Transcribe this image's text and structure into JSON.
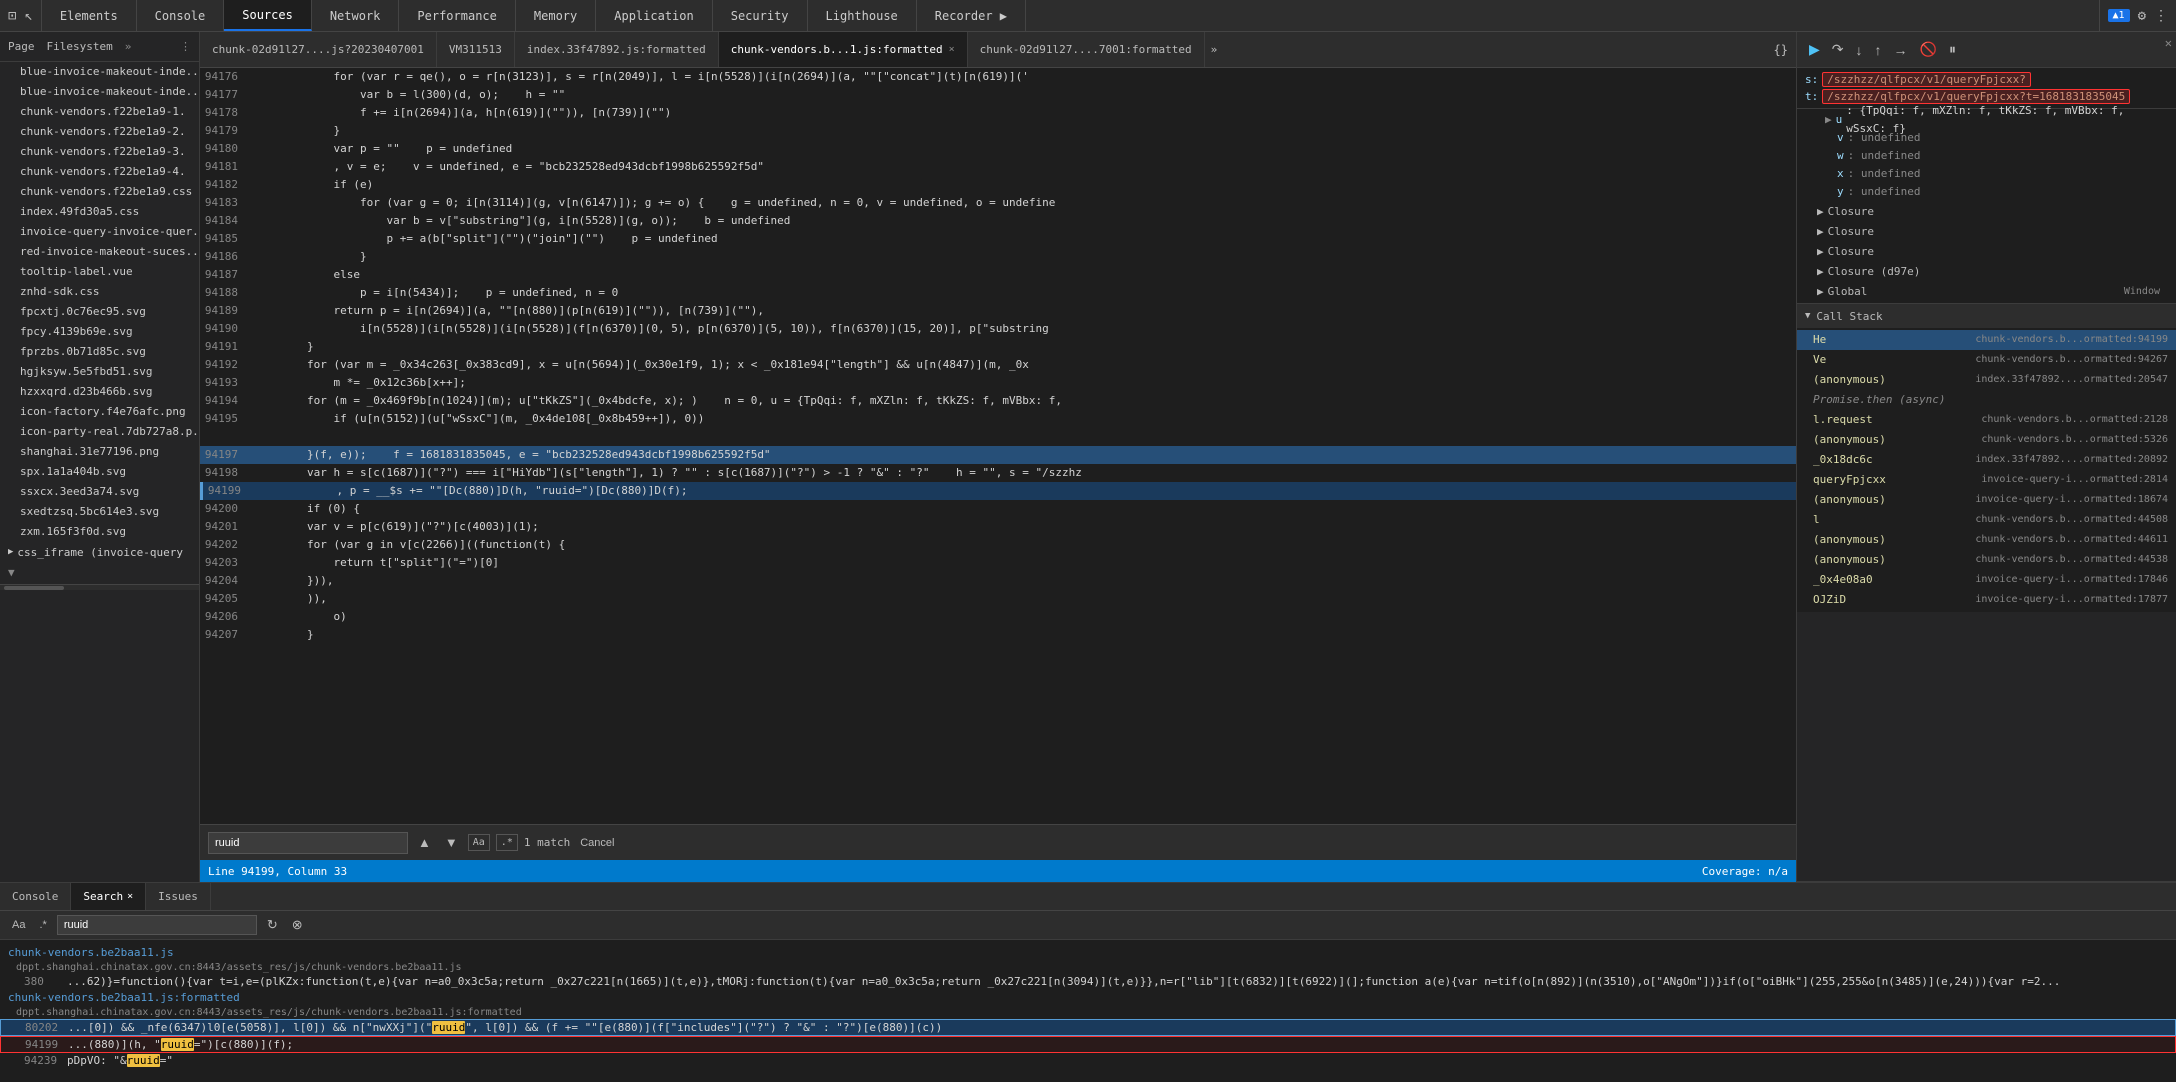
{
  "tabs": {
    "items": [
      "Elements",
      "Console",
      "Sources",
      "Network",
      "Performance",
      "Memory",
      "Application",
      "Security",
      "Lighthouse",
      "Recorder ▶"
    ]
  },
  "topbar": {
    "active_tab": "Sources",
    "icons": {
      "device": "⊡",
      "elements": "☰",
      "settings": "⚙",
      "overflow": "⋮"
    }
  },
  "sidebar": {
    "header_tabs": [
      "Page",
      "Filesystem"
    ],
    "more": "»",
    "files": [
      "blue-invoice-makeout-inde...",
      "blue-invoice-makeout-inde...",
      "chunk-vendors.f22be1a9-1.",
      "chunk-vendors.f22be1a9-2.",
      "chunk-vendors.f22be1a9-3.",
      "chunk-vendors.f22be1a9-4.",
      "chunk-vendors.f22be1a9.css",
      "index.49fd30a5.css",
      "invoice-query-invoice-quer...",
      "red-invoice-makeout-suces...",
      "tooltip-label.vue",
      "znhd-sdk.css",
      "fpcxtj.0c76ec95.svg",
      "fpcy.4139b69e.svg",
      "fprzbs.0b71d85c.svg",
      "hgjksyw.5e5fbd51.svg",
      "hzxxqrd.d23b466b.svg",
      "icon-factory.f4e76afc.png",
      "icon-party-real.7db727a8.p...",
      "shanghai.31e77196.png",
      "spx.1a1a404b.svg",
      "ssxcx.3eed3a74.svg",
      "sxedtzsq.5bc614e3.svg",
      "zxm.165f3f0d.svg"
    ],
    "groups": [
      "css_iframe (invoice-query"
    ]
  },
  "file_tabs": [
    {
      "name": "chunk-02d91l27....js?20230407001",
      "active": false,
      "closable": false
    },
    {
      "name": "VM311513",
      "active": false,
      "closable": false
    },
    {
      "name": "index.33f47892.js:formatted",
      "active": false,
      "closable": false
    },
    {
      "name": "chunk-vendors.b...1.js:formatted",
      "active": true,
      "closable": true
    },
    {
      "name": "chunk-02d91l27....7001:formatted",
      "active": false,
      "closable": false
    }
  ],
  "code": {
    "lines": [
      {
        "num": "94176",
        "content": "            for (var r = qe(), o = r[n(3123)], s = r[n(2049)], l = i[n(5528)](i[n(2694)](a, \"\"[\"concat\"](t)[n(619)]('",
        "highlighted": false,
        "current": false
      },
      {
        "num": "94177",
        "content": "                var b = l(300)(d, o);    h = \"\"",
        "highlighted": false,
        "current": false
      },
      {
        "num": "94178",
        "content": "                f += i[n(2694)](a, h[n(619)](\"\")), [n(739)](\"\")",
        "highlighted": false,
        "current": false
      },
      {
        "num": "94179",
        "content": "            }",
        "highlighted": false,
        "current": false
      },
      {
        "num": "94180",
        "content": "            var p = \"\"    p = undefined",
        "highlighted": false,
        "current": false
      },
      {
        "num": "94181",
        "content": "            , v = e;    v = undefined, e = \"bcb232528ed943dcbf1998b625592f5d\"",
        "highlighted": false,
        "current": false
      },
      {
        "num": "94182",
        "content": "            if (e)",
        "highlighted": false,
        "current": false
      },
      {
        "num": "94183",
        "content": "                for (var g = 0; i[n(3114)](g, v[n(6147)]); g += o) {    g = undefined, n = 0, v = undefined, o = undefine",
        "highlighted": false,
        "current": false
      },
      {
        "num": "94184",
        "content": "                    var b = v[\"substring\"](g, i[n(5528)](g, o));    b = undefined",
        "highlighted": false,
        "current": false
      },
      {
        "num": "94185",
        "content": "                    p += a(b[\"split\"](\"\")(\"join\"](\"\")    p = undefined",
        "highlighted": false,
        "current": false
      },
      {
        "num": "94186",
        "content": "                }",
        "highlighted": false,
        "current": false
      },
      {
        "num": "94187",
        "content": "            else",
        "highlighted": false,
        "current": false
      },
      {
        "num": "94188",
        "content": "                p = i[n(5434)];    p = undefined, n = 0",
        "highlighted": false,
        "current": false
      },
      {
        "num": "94189",
        "content": "            return p = i[n(2694)](a, \"\"[n(880)](p[n(619)](\"\")), [n(739)](\"\"),",
        "highlighted": false,
        "current": false
      },
      {
        "num": "94190",
        "content": "                i[n(5528)](i[n(5528)](i[n(5528)](f[n(6370)](0, 5), p[n(6370)](5, 10)), f[n(6370)](15, 20)], p[\"substring",
        "highlighted": false,
        "current": false
      },
      {
        "num": "94191",
        "content": "        }",
        "highlighted": false,
        "current": false
      },
      {
        "num": "94192",
        "content": "        for (var m = _0x34c263[_0x383cd9], x = u[n(5694)](_0x30e1f9, 1); x < _0x181e94[\"length\"] && u[n(4847)](m, _0x",
        "highlighted": false,
        "current": false
      },
      {
        "num": "94193",
        "content": "            m *= _0x12c36b[x++];",
        "highlighted": false,
        "current": false
      },
      {
        "num": "94194",
        "content": "        for (m = _0x469f9b[n(1024)](m); u[\"tKkZS\"](_0x4bdcfe, x); )    n = 0, u = {TpQqi: f, mXZln: f, tKkZS: f, mVBbx: f,",
        "highlighted": false,
        "current": false
      },
      {
        "num": "94195",
        "content": "            if (u[n(5152)](u[\"wSsxC\"](m, _0x4de108[_0x8b459++]), 0))",
        "highlighted": false,
        "current": false
      },
      {
        "num": "",
        "content": "",
        "highlighted": false,
        "current": false
      },
      {
        "num": "94197",
        "content": "        }(f, e));    f = 1681831835045, e = \"bcb232528ed943dcbf1998b625592f5d\"",
        "highlighted": true,
        "current": false
      },
      {
        "num": "94198",
        "content": "        var h = s[c(1687)](\"?\") === i[\"HiYdb\"](s[\"length\"], 1) ? \"\" : s[c(1687)](\"?\") > -1 ? \"&\" : \"?\"    h = \"\", s = \"/szzhz",
        "highlighted": false,
        "current": false
      },
      {
        "num": "94199",
        "content": "            , p = __$s += \"\"[Dc(880)]D(h, \"ruuid=\")[Dc(880)]D(f);",
        "highlighted": false,
        "current": true
      },
      {
        "num": "94200",
        "content": "        if (0) {",
        "highlighted": false,
        "current": false
      },
      {
        "num": "94201",
        "content": "        var v = p[c(619)](\"?\")[c(4003)](1);",
        "highlighted": false,
        "current": false
      },
      {
        "num": "94202",
        "content": "        for (var g in v[c(2266)]((function(t) {",
        "highlighted": false,
        "current": false
      },
      {
        "num": "94203",
        "content": "            return t[\"split\"](\"=\")[0]",
        "highlighted": false,
        "current": false
      },
      {
        "num": "94204",
        "content": "        })),",
        "highlighted": false,
        "current": false
      },
      {
        "num": "94205",
        "content": "        )),",
        "highlighted": false,
        "current": false
      },
      {
        "num": "94206",
        "content": "            o)",
        "highlighted": false,
        "current": false
      },
      {
        "num": "94207",
        "content": "        }",
        "highlighted": false,
        "current": false
      }
    ]
  },
  "right_panel": {
    "toolbar": {
      "buttons": [
        "▶",
        "⏸",
        "↷",
        "↓",
        "↑",
        "⏫",
        "⏬",
        "🚫",
        "⏹"
      ]
    },
    "network_highlighted": {
      "s_value": "/szzhzz/qlfpcx/v1/queryFpjcxx?",
      "t_value": "/szzhzz/qlfpcx/v1/queryFpjcxx?t=1681831835045"
    },
    "scope_items": [
      {
        "type": "object",
        "key": "u",
        "val": "{TpQqi: f, mXZln: f, tKkZS: f, mVBbx: f, wSsxC: f}"
      },
      {
        "type": "value",
        "key": "v",
        "val": "undefined"
      },
      {
        "type": "value",
        "key": "w",
        "val": ""
      },
      {
        "type": "value",
        "key": "x",
        "val": "undefined"
      },
      {
        "type": "value",
        "key": "y",
        "val": "undefined"
      },
      {
        "group": "Closure",
        "expanded": false
      },
      {
        "group": "Closure",
        "expanded": false
      },
      {
        "group": "Closure",
        "expanded": false
      },
      {
        "group": "Closure (d97e)",
        "expanded": false
      },
      {
        "group": "Global",
        "expanded": false,
        "extra": "Window"
      }
    ],
    "call_stack": {
      "header": "Call Stack",
      "items": [
        {
          "fn": "He",
          "loc": "chunk-vendors.b...ormatted:94199",
          "active": true
        },
        {
          "fn": "Ve",
          "loc": "chunk-vendors.b...ormatted:94267",
          "active": false
        },
        {
          "fn": "(anonymous)",
          "loc": "index.33f47892....ormatted:20547",
          "active": false
        },
        {
          "fn": "Promise.then (async)",
          "loc": "",
          "active": false,
          "is_async": true
        },
        {
          "fn": "l.request",
          "loc": "chunk-vendors.b...ormatted:2128",
          "active": false
        },
        {
          "fn": "(anonymous)",
          "loc": "chunk-vendors.b...ormatted:5326",
          "active": false
        },
        {
          "fn": "_0x18dc6c",
          "loc": "index.33f47892....ormatted:20892",
          "active": false
        },
        {
          "fn": "queryFpjcxx",
          "loc": "invoice-query-i...ormatted:2814",
          "active": false
        },
        {
          "fn": "(anonymous)",
          "loc": "invoice-query-i...ormatted:18674",
          "active": false
        },
        {
          "fn": "l",
          "loc": "chunk-vendors.b...ormatted:44508",
          "active": false
        },
        {
          "fn": "(anonymous)",
          "loc": "chunk-vendors.b...ormatted:44611",
          "active": false
        },
        {
          "fn": "(anonymous)",
          "loc": "chunk-vendors.b...ormatted:44538",
          "active": false
        },
        {
          "fn": "_0x4e08a0",
          "loc": "invoice-query-i...ormatted:17846",
          "active": false
        },
        {
          "fn": "OJZiD",
          "loc": "invoice-query-i...ormatted:17877",
          "active": false
        }
      ]
    }
  },
  "bottom_area": {
    "tabs": [
      "Console",
      "Search ×",
      "Issues"
    ],
    "active_tab": "Search",
    "search": {
      "toggle_case": "Aa",
      "toggle_regex": ".*",
      "input_value": "ruuid",
      "refresh_icon": "↻",
      "clear_icon": "⊗"
    },
    "search_results": [
      {
        "file": "chunk-vendors.be2baa11.js",
        "url": "dppt.shanghai.chinatax.gov.cn:8443/assets_res/js/chunk-vendors.be2baa11.js",
        "lines": [
          {
            "num": "380",
            "content": "...62)}=function(){var t=i,e=(plKZx:function(t,e){var n=a0_0x3c5a;return _0x27c221[n(1665)](t,e)},tMORj:function(t){var n=a0_0x3c5a;return _0x27c221[n(3094)](t,e)}},n=r[\"lib\"][t(6832)][t(6922)](];function a(e){var n=tif(o[n(892)](n(3510),o[\"ANgOm\"])}if(o[\"oiBHk\"](255,255&o[n(3485)](e,24))){var r=2...",
            "match_start": 0,
            "highlight": false
          }
        ]
      },
      {
        "file": "chunk-vendors.be2baa11.js:formatted",
        "url": "dppt.shanghai.chinatax.gov.cn:8443/assets_res/js/chunk-vendors.be2baa11.js:formatted",
        "lines": [
          {
            "num": "80202",
            "content": "...[0]) && _nfe(6347)l0[e(5058)], l[0]) && n[\"nwXXj\"](\"ruuid\", l[0]) && (f += \"\"[e(880)](f[\"includes\"](\"?\") ? \"&\" : \"?\")[e(880)](c))",
            "match_start": 0,
            "highlight": true,
            "is_current": true
          },
          {
            "num": "94199",
            "content": "...(880)](h, \"ruuid=\")[c(880)](f);",
            "match_start": 0,
            "highlight": true,
            "is_current": false,
            "is_highlighted_box": true
          },
          {
            "num": "94239",
            "content": "pDpVO: \"&ruuid=\"",
            "match_start": 0,
            "highlight": false
          }
        ]
      }
    ]
  },
  "status_bar": {
    "line_col": "Line 94199, Column 33",
    "coverage": "Coverage: n/a"
  },
  "search_bar_inline": {
    "count": "1 match",
    "cancel": "Cancel"
  }
}
